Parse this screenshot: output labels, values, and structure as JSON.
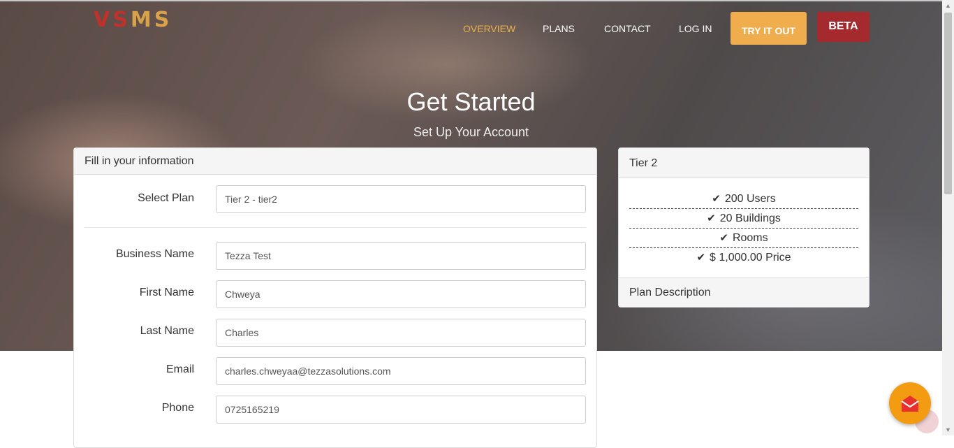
{
  "header": {
    "logo_text_a": "VS",
    "logo_text_b": "M",
    "logo_text_c": "S",
    "nav": [
      {
        "label": "OVERVIEW",
        "active": true
      },
      {
        "label": "PLANS",
        "active": false
      },
      {
        "label": "CONTACT",
        "active": false
      },
      {
        "label": "LOG IN",
        "active": false
      }
    ],
    "try_label": "TRY IT OUT",
    "beta_label": "BETA"
  },
  "hero": {
    "title": "Get Started",
    "subtitle": "Set Up Your Account"
  },
  "form": {
    "heading": "Fill in your information",
    "fields": [
      {
        "label": "Select Plan",
        "value": "Tier 2 - tier2"
      },
      {
        "label": "Business Name",
        "value": "Tezza Test"
      },
      {
        "label": "First Name",
        "value": "Chweya"
      },
      {
        "label": "Last Name",
        "value": "Charles"
      },
      {
        "label": "Email",
        "value": "charles.chweyaa@tezzasolutions.com"
      },
      {
        "label": "Phone",
        "value": "0725165219"
      }
    ]
  },
  "plan": {
    "title": "Tier 2",
    "features": [
      "200 Users",
      "20 Buildings",
      "Rooms",
      "$ 1,000.00 Price"
    ],
    "description_label": "Plan Description"
  },
  "colors": {
    "accent_orange": "#f0ad4e",
    "beta_red": "#a52a2e",
    "nav_active": "#e8b04e",
    "logo_red": "#c0312b",
    "logo_gold": "#d8a24a"
  },
  "icons": {
    "check": "check-icon",
    "chat": "envelope-icon"
  }
}
